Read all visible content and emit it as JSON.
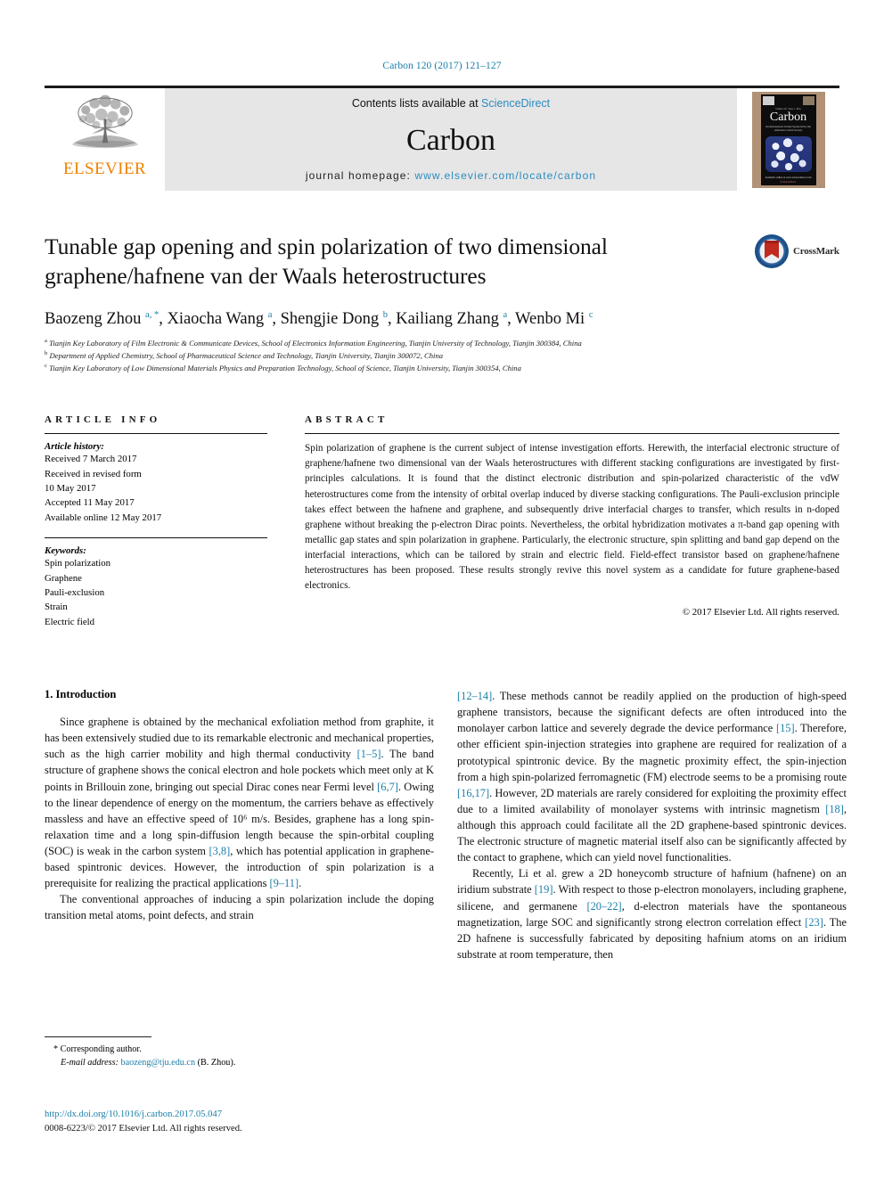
{
  "running_head": "Carbon 120 (2017) 121–127",
  "masthead": {
    "contents_prefix": "Contents lists available at ",
    "contents_link": "ScienceDirect",
    "journal_title": "Carbon",
    "homepage_prefix": "journal homepage: ",
    "homepage_url": "www.elsevier.com/locate/carbon",
    "publisher_logo_word": "ELSEVIER",
    "publisher_logo_icon": "elsevier-tree-icon",
    "cover_title": "Carbon",
    "cover_subtitle": "An International Journal Sponsored by the American Carbon Society",
    "cover_volume": "Volume 120 / Issue 1 / May",
    "cover_footer": "Available online at www.sciencedirect.com",
    "cover_publisher": "ScienceDirect"
  },
  "crossmark": {
    "label": "CrossMark",
    "icon": "crossmark-icon"
  },
  "article": {
    "title": "Tunable gap opening and spin polarization of two dimensional graphene/hafnene van der Waals heterostructures",
    "authors": [
      {
        "name": "Baozeng Zhou",
        "marks": "a, *"
      },
      {
        "name": "Xiaocha Wang",
        "marks": "a"
      },
      {
        "name": "Shengjie Dong",
        "marks": "b"
      },
      {
        "name": "Kailiang Zhang",
        "marks": "a"
      },
      {
        "name": "Wenbo Mi",
        "marks": "c"
      }
    ],
    "affiliations": [
      {
        "mark": "a",
        "text": "Tianjin Key Laboratory of Film Electronic & Communicate Devices, School of Electronics Information Engineering, Tianjin University of Technology, Tianjin 300384, China"
      },
      {
        "mark": "b",
        "text": "Department of Applied Chemistry, School of Pharmaceutical Science and Technology, Tianjin University, Tianjin 300072, China"
      },
      {
        "mark": "c",
        "text": "Tianjin Key Laboratory of Low Dimensional Materials Physics and Preparation Technology, School of Science, Tianjin University, Tianjin 300354, China"
      }
    ]
  },
  "article_info": {
    "heading": "ARTICLE INFO",
    "history_label": "Article history:",
    "history": [
      "Received 7 March 2017",
      "Received in revised form",
      "10 May 2017",
      "Accepted 11 May 2017",
      "Available online 12 May 2017"
    ],
    "keywords_label": "Keywords:",
    "keywords": [
      "Spin polarization",
      "Graphene",
      "Pauli-exclusion",
      "Strain",
      "Electric field"
    ]
  },
  "abstract": {
    "heading": "ABSTRACT",
    "text": "Spin polarization of graphene is the current subject of intense investigation efforts. Herewith, the interfacial electronic structure of graphene/hafnene two dimensional van der Waals heterostructures with different stacking configurations are investigated by first-principles calculations. It is found that the distinct electronic distribution and spin-polarized characteristic of the vdW heterostructures come from the intensity of orbital overlap induced by diverse stacking configurations. The Pauli-exclusion principle takes effect between the hafnene and graphene, and subsequently drive interfacial charges to transfer, which results in n-doped graphene without breaking the p-electron Dirac points. Nevertheless, the orbital hybridization motivates a π-band gap opening with metallic gap states and spin polarization in graphene. Particularly, the electronic structure, spin splitting and band gap depend on the interfacial interactions, which can be tailored by strain and electric field. Field-effect transistor based on graphene/hafnene heterostructures has been proposed. These results strongly revive this novel system as a candidate for future graphene-based electronics.",
    "copyright": "© 2017 Elsevier Ltd. All rights reserved."
  },
  "body": {
    "section_title": "1. Introduction",
    "left_paragraphs": [
      "Since graphene is obtained by the mechanical exfoliation method from graphite, it has been extensively studied due to its remarkable electronic and mechanical properties, such as the high carrier mobility and high thermal conductivity [1–5]. The band structure of graphene shows the conical electron and hole pockets which meet only at K points in Brillouin zone, bringing out special Dirac cones near Fermi level [6,7]. Owing to the linear dependence of energy on the momentum, the carriers behave as effectively massless and have an effective speed of 10⁶ m/s. Besides, graphene has a long spin-relaxation time and a long spin-diffusion length because the spin-orbital coupling (SOC) is weak in the carbon system [3,8], which has potential application in graphene-based spintronic devices. However, the introduction of spin polarization is a prerequisite for realizing the practical applications [9–11].",
      "The conventional approaches of inducing a spin polarization include the doping transition metal atoms, point defects, and strain"
    ],
    "right_paragraphs": [
      "[12–14]. These methods cannot be readily applied on the production of high-speed graphene transistors, because the significant defects are often introduced into the monolayer carbon lattice and severely degrade the device performance [15]. Therefore, other efficient spin-injection strategies into graphene are required for realization of a prototypical spintronic device. By the magnetic proximity effect, the spin-injection from a high spin-polarized ferromagnetic (FM) electrode seems to be a promising route [16,17]. However, 2D materials are rarely considered for exploiting the proximity effect due to a limited availability of monolayer systems with intrinsic magnetism [18], although this approach could facilitate all the 2D graphene-based spintronic devices. The electronic structure of magnetic material itself also can be significantly affected by the contact to graphene, which can yield novel functionalities.",
      "Recently, Li et al. grew a 2D honeycomb structure of hafnium (hafnene) on an iridium substrate [19]. With respect to those p-electron monolayers, including graphene, silicene, and germanene [20–22], d-electron materials have the spontaneous magnetization, large SOC and significantly strong electron correlation effect [23]. The 2D hafnene is successfully fabricated by depositing hafnium atoms on an iridium substrate at room temperature, then"
    ]
  },
  "footnote": {
    "corresponding_marker": "*",
    "corresponding_text": "Corresponding author.",
    "email_label": "E-mail address:",
    "email": "baozeng@tju.edu.cn",
    "email_owner": "(B. Zhou)."
  },
  "footer": {
    "doi": "http://dx.doi.org/10.1016/j.carbon.2017.05.047",
    "issn_line": "0008-6223/© 2017 Elsevier Ltd. All rights reserved."
  },
  "colors": {
    "link": "#1a7fa8",
    "elsevier_orange": "#ef8200",
    "masthead_bg": "#e6e6e6"
  }
}
